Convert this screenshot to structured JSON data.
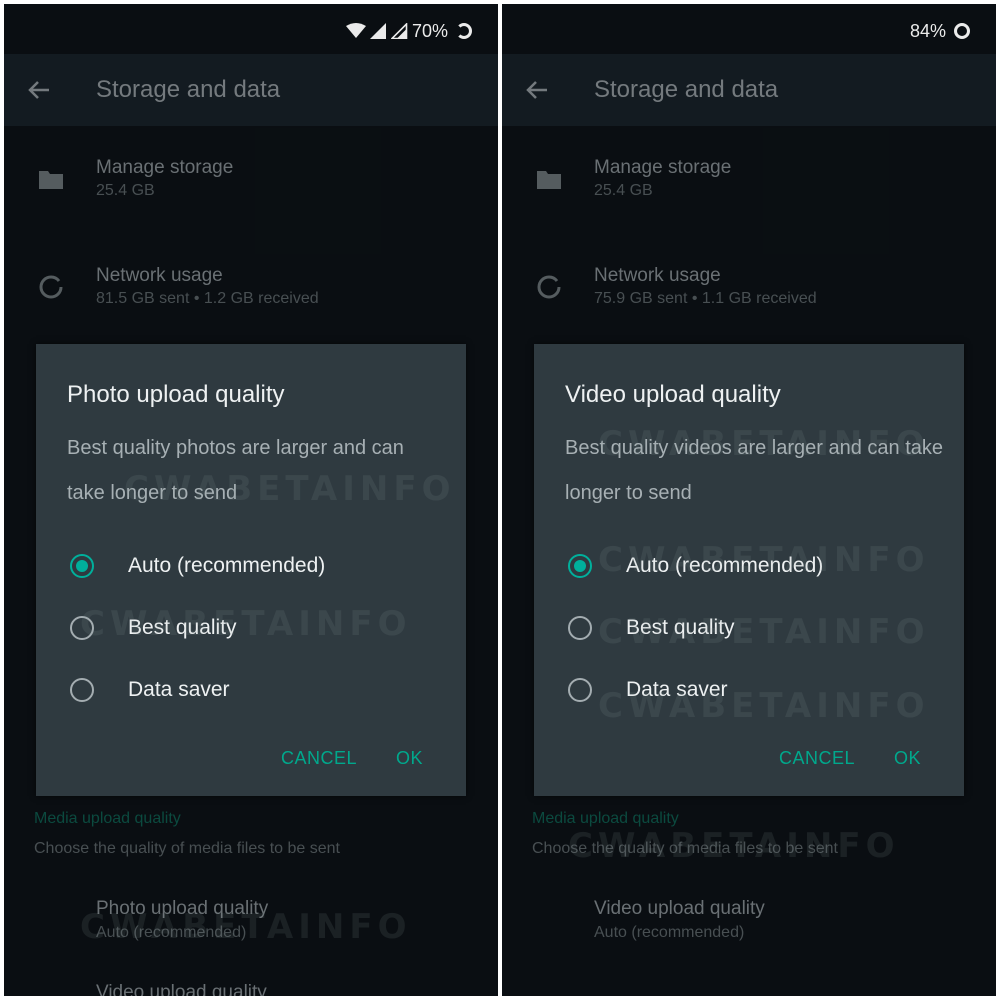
{
  "left": {
    "status": {
      "battery": "70%"
    },
    "appbar": {
      "title": "Storage and data"
    },
    "manage_storage": {
      "title": "Manage storage",
      "subtitle": "25.4 GB"
    },
    "network_usage": {
      "title": "Network usage",
      "subtitle": "81.5 GB sent • 1.2 GB received"
    },
    "section": {
      "label": "Media upload quality",
      "description": "Choose the quality of media files to be sent"
    },
    "setting_1": {
      "title": "Photo upload quality",
      "subtitle": "Auto (recommended)"
    },
    "setting_2": {
      "title": "Video upload quality"
    },
    "dialog": {
      "title": "Photo upload quality",
      "message": "Best quality photos are larger and can take longer to send",
      "options": [
        "Auto (recommended)",
        "Best quality",
        "Data saver"
      ],
      "selected": "Auto (recommended)",
      "cancel": "CANCEL",
      "ok": "OK"
    }
  },
  "right": {
    "status": {
      "battery": "84%"
    },
    "appbar": {
      "title": "Storage and data"
    },
    "manage_storage": {
      "title": "Manage storage",
      "subtitle": "25.4 GB"
    },
    "network_usage": {
      "title": "Network usage",
      "subtitle": "75.9 GB sent • 1.1 GB received"
    },
    "section": {
      "label": "Media upload quality",
      "description": "Choose the quality of media files to be sent"
    },
    "setting_1": {
      "title": "Video upload quality",
      "subtitle": "Auto (recommended)"
    },
    "dialog": {
      "title": "Video upload quality",
      "message": "Best quality videos are larger and can take longer to send",
      "options": [
        "Auto (recommended)",
        "Best quality",
        "Data saver"
      ],
      "selected": "Auto (recommended)",
      "cancel": "CANCEL",
      "ok": "OK"
    }
  },
  "watermark": "CWABETAINFO",
  "colors": {
    "accent": "#00a88c",
    "dialog_bg": "#2f3a40",
    "screen_bg": "#0b1014"
  },
  "icons": [
    "wifi-icon",
    "signal-icon",
    "battery-ring-icon",
    "back-arrow-icon",
    "folder-icon",
    "data-usage-icon"
  ]
}
